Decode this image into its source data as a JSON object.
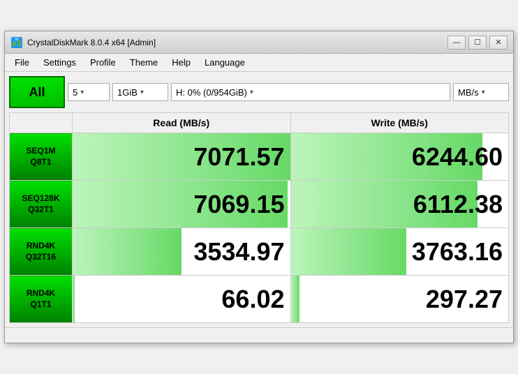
{
  "window": {
    "title": "CrystalDiskMark 8.0.4 x64 [Admin]",
    "icon_text": "💿"
  },
  "title_controls": {
    "minimize": "—",
    "maximize": "☐",
    "close": "✕"
  },
  "menu": {
    "items": [
      "File",
      "Settings",
      "Profile",
      "Theme",
      "Help",
      "Language"
    ]
  },
  "controls": {
    "all_button": "All",
    "count_value": "5",
    "count_arrow": "▾",
    "size_value": "1GiB",
    "size_arrow": "▾",
    "drive_value": "H: 0% (0/954GiB)",
    "drive_arrow": "▾",
    "unit_value": "MB/s",
    "unit_arrow": "▾"
  },
  "table": {
    "header_read": "Read (MB/s)",
    "header_write": "Write (MB/s)",
    "rows": [
      {
        "label_line1": "SEQ1M",
        "label_line2": "Q8T1",
        "read": "7071.57",
        "write": "6244.60",
        "read_pct": 100,
        "write_pct": 88
      },
      {
        "label_line1": "SEQ128K",
        "label_line2": "Q32T1",
        "read": "7069.15",
        "write": "6112.38",
        "read_pct": 99,
        "write_pct": 86
      },
      {
        "label_line1": "RND4K",
        "label_line2": "Q32T16",
        "read": "3534.97",
        "write": "3763.16",
        "read_pct": 50,
        "write_pct": 53
      },
      {
        "label_line1": "RND4K",
        "label_line2": "Q1T1",
        "read": "66.02",
        "write": "297.27",
        "read_pct": 1,
        "write_pct": 4
      }
    ]
  },
  "status_bar": {
    "text": ""
  }
}
